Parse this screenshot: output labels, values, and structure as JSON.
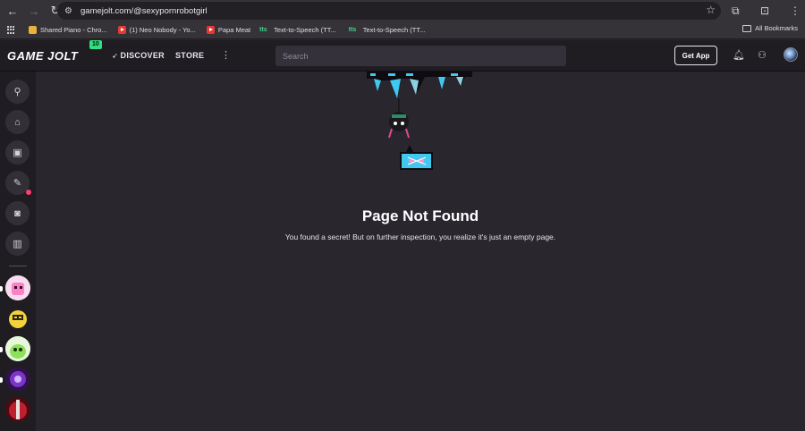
{
  "browser": {
    "url": "gamejolt.com/@sexypornrobotgirl",
    "bookmarks": [
      {
        "label": "Shared Piano - Chro...",
        "favicon": "yellow"
      },
      {
        "label": "(1) Neo Nobody - Yo...",
        "favicon": "youtube"
      },
      {
        "label": "Papa Meat",
        "favicon": "youtube"
      },
      {
        "label": "Text-to-Speech (TT...",
        "favicon": "tts"
      },
      {
        "label": "Text-to-Speech (TT...",
        "favicon": "tts"
      }
    ],
    "all_bookmarks": "All Bookmarks"
  },
  "header": {
    "logo": "GAME JOLT",
    "badge": "10",
    "nav": {
      "discover": "DISCOVER",
      "store": "STORE"
    },
    "search_placeholder": "Search",
    "get_app": "Get App"
  },
  "main": {
    "title": "Page Not Found",
    "message": "You found a secret! But on further inspection, you realize it's just an empty page."
  },
  "colors": {
    "background": "#2a262e",
    "header": "#1f1c22",
    "accent_green": "#2fe07d",
    "notification": "#ff3d6e",
    "art_cyan": "#3fc8f0"
  }
}
